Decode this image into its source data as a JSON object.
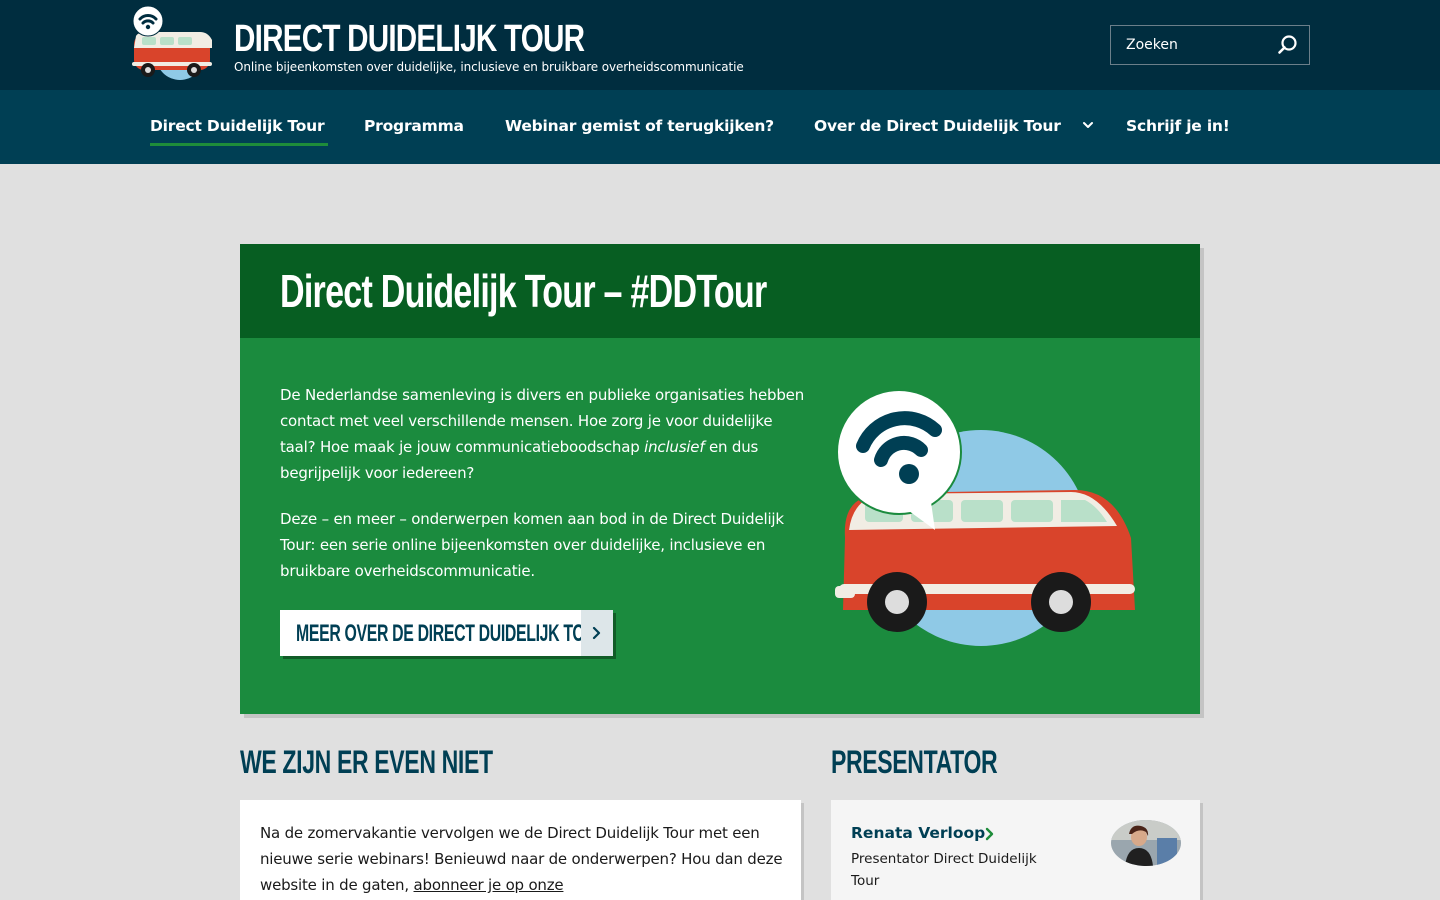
{
  "header": {
    "title": "DIRECT DUIDELIJK TOUR",
    "tagline": "Online bijeenkomsten over duidelijke, inclusieve en bruikbare overheidscommunicatie",
    "search_placeholder": "Zoeken",
    "search_icon": "search-icon"
  },
  "nav": {
    "items": [
      {
        "label": "Direct Duidelijk Tour",
        "active": true
      },
      {
        "label": "Programma"
      },
      {
        "label": "Webinar gemist of terugkijken?"
      },
      {
        "label": "Over de Direct Duidelijk Tour",
        "has_dropdown": true
      },
      {
        "label": "Schrijf je in!"
      }
    ]
  },
  "hero": {
    "title": "Direct Duidelijk Tour – #DDTour",
    "paragraph1_before": "De Nederlandse samenleving is divers en publieke organisaties hebben contact met veel verschillende mensen. Hoe zorg je voor duidelijke taal? Hoe maak je jouw communicatieboodschap ",
    "paragraph1_emphasis": "inclusief",
    "paragraph1_after": " en dus begrijpelijk voor iedereen?",
    "paragraph2": "Deze – en meer – onderwerpen komen aan bod in de Direct Duidelijk Tour: een serie online bijeenkomsten over duidelijke, inclusieve en bruikbare overheidscommunicatie.",
    "cta_label": "MEER OVER DE DIRECT DUIDELIJK TOUR"
  },
  "notice": {
    "title": "WE ZIJN ER EVEN NIET",
    "text": "Na de zomervakantie vervolgen we de Direct Duidelijk Tour met een nieuwe serie webinars! Benieuwd naar de onderwerpen? Hou dan deze website in de gaten, ",
    "link": "abonneer je op onze"
  },
  "presenter": {
    "title": "PRESENTATOR",
    "name": "Renata Verloop",
    "role": "Presentator Direct Duidelijk Tour"
  },
  "colors": {
    "header_bg": "#002d3f",
    "nav_bg": "#003f54",
    "hero_head": "#075e22",
    "hero_body": "#1b8b3e",
    "active_underline": "#1e8c3a",
    "page_bg": "#e0e0e0"
  }
}
